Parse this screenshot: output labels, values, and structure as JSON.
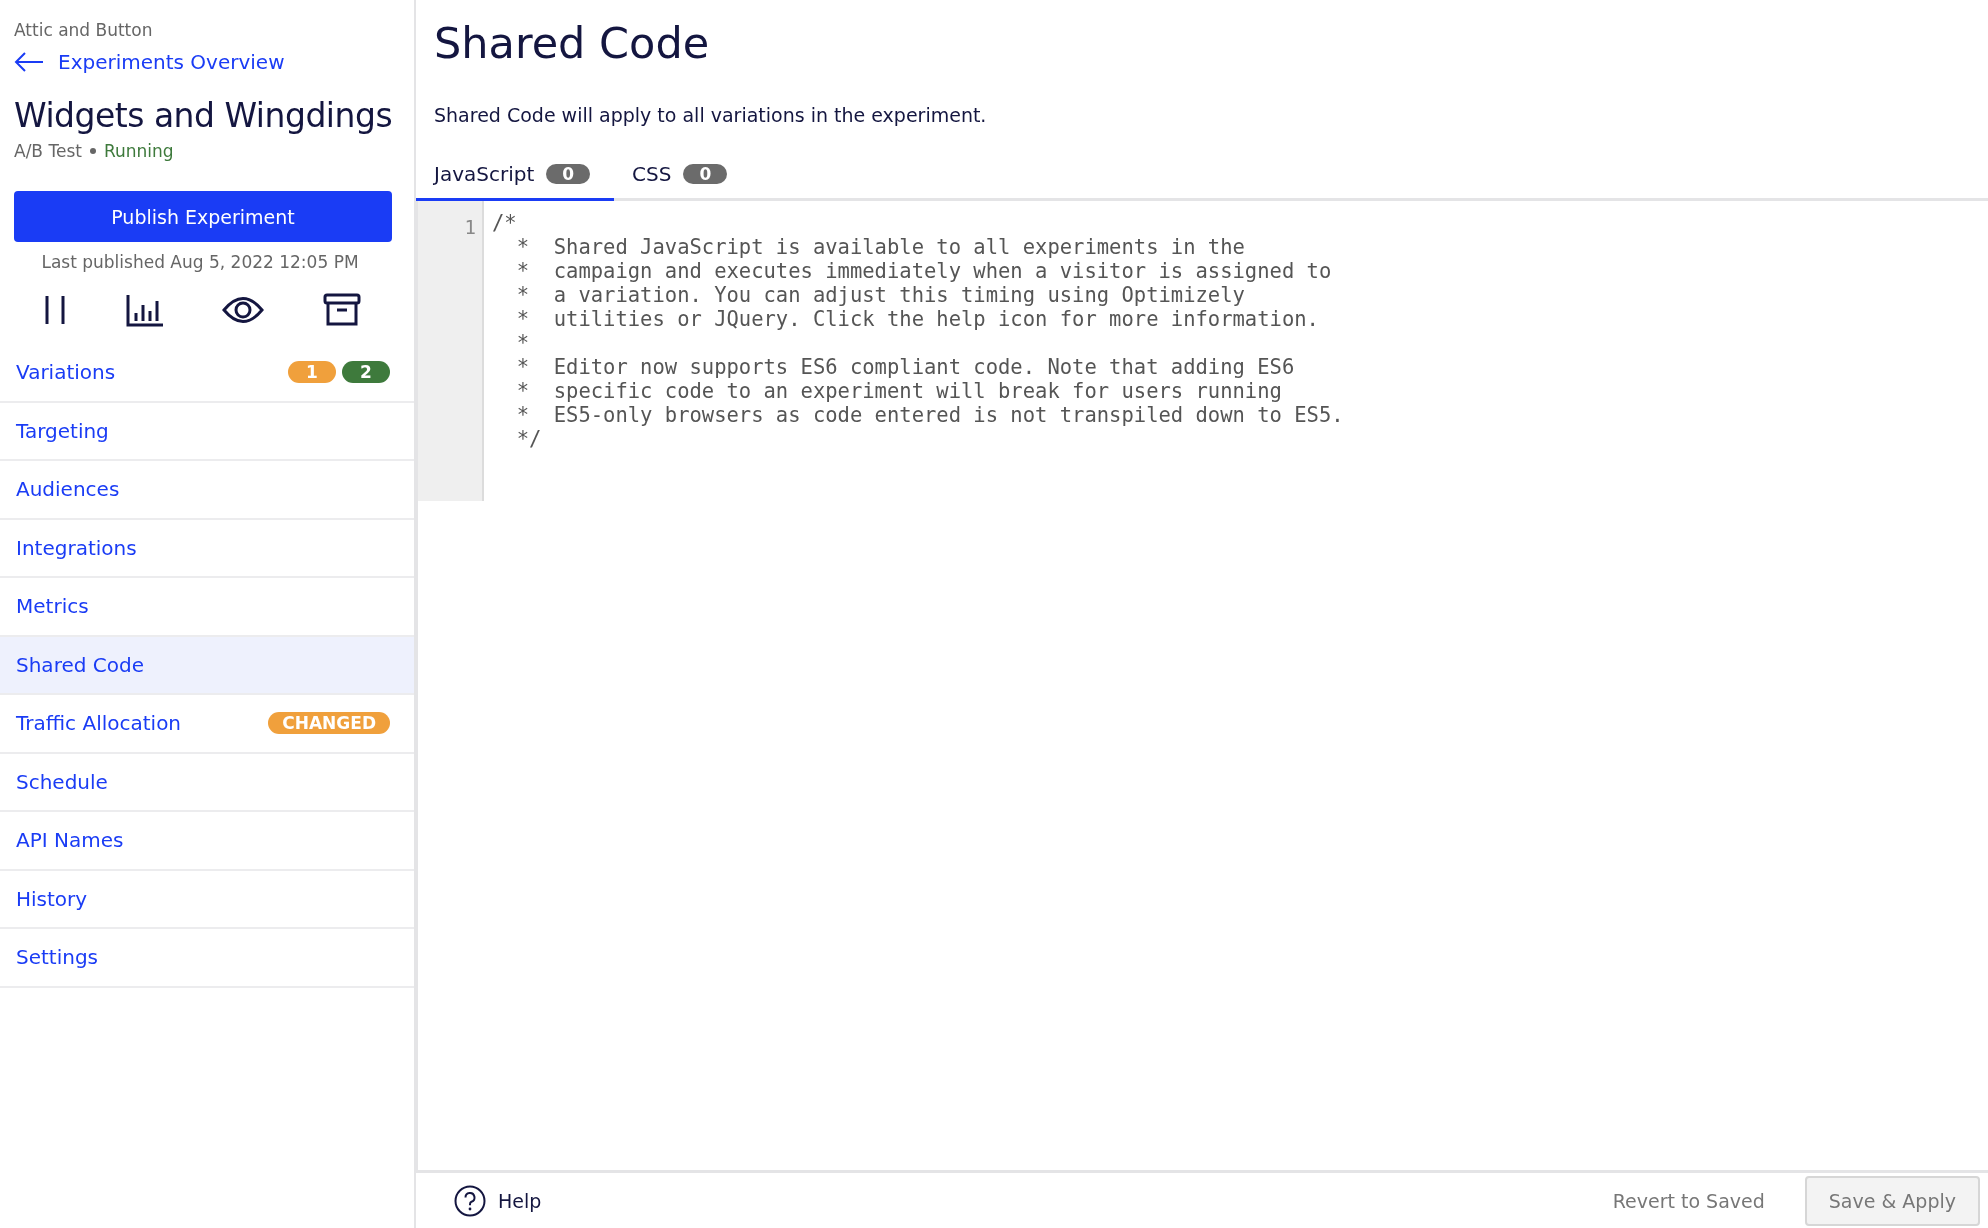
{
  "sidebar": {
    "project": "Attic and Button",
    "back_link": "Experiments Overview",
    "experiment_title": "Widgets and Wingdings",
    "experiment_type": "A/B Test",
    "status": "Running",
    "publish_button": "Publish Experiment",
    "last_published": "Last published Aug 5, 2022 12:05 PM",
    "nav_items": [
      {
        "label": "Variations",
        "selected": false,
        "badges": [
          {
            "text": "1",
            "color": "#f0a03c"
          },
          {
            "text": "2",
            "color": "#3e7a3c"
          }
        ]
      },
      {
        "label": "Targeting",
        "selected": false
      },
      {
        "label": "Audiences",
        "selected": false
      },
      {
        "label": "Integrations",
        "selected": false
      },
      {
        "label": "Metrics",
        "selected": false
      },
      {
        "label": "Shared Code",
        "selected": true
      },
      {
        "label": "Traffic Allocation",
        "selected": false,
        "badges": [
          {
            "text": "CHANGED",
            "color": "#f0a03c"
          }
        ]
      },
      {
        "label": "Schedule",
        "selected": false
      },
      {
        "label": "API Names",
        "selected": false
      },
      {
        "label": "History",
        "selected": false
      },
      {
        "label": "Settings",
        "selected": false
      }
    ]
  },
  "main": {
    "title": "Shared Code",
    "description": "Shared Code will apply to all variations in the experiment.",
    "tabs": [
      {
        "label": "JavaScript",
        "count": "0",
        "selected": true
      },
      {
        "label": "CSS",
        "count": "0",
        "selected": false
      }
    ],
    "editor": {
      "line_numbers": [
        "1"
      ],
      "code_lines": [
        "/*",
        "  *  Shared JavaScript is available to all experiments in the",
        "  *  campaign and executes immediately when a visitor is assigned to",
        "  *  a variation. You can adjust this timing using Optimizely",
        "  *  utilities or JQuery. Click the help icon for more information.",
        "  *",
        "  *  Editor now supports ES6 compliant code. Note that adding ES6",
        "  *  specific code to an experiment will break for users running",
        "  *  ES5-only browsers as code entered is not transpiled down to ES5.",
        "  */"
      ]
    },
    "footer": {
      "help": "Help",
      "revert_button": "Revert to Saved",
      "save_button": "Save & Apply"
    }
  }
}
